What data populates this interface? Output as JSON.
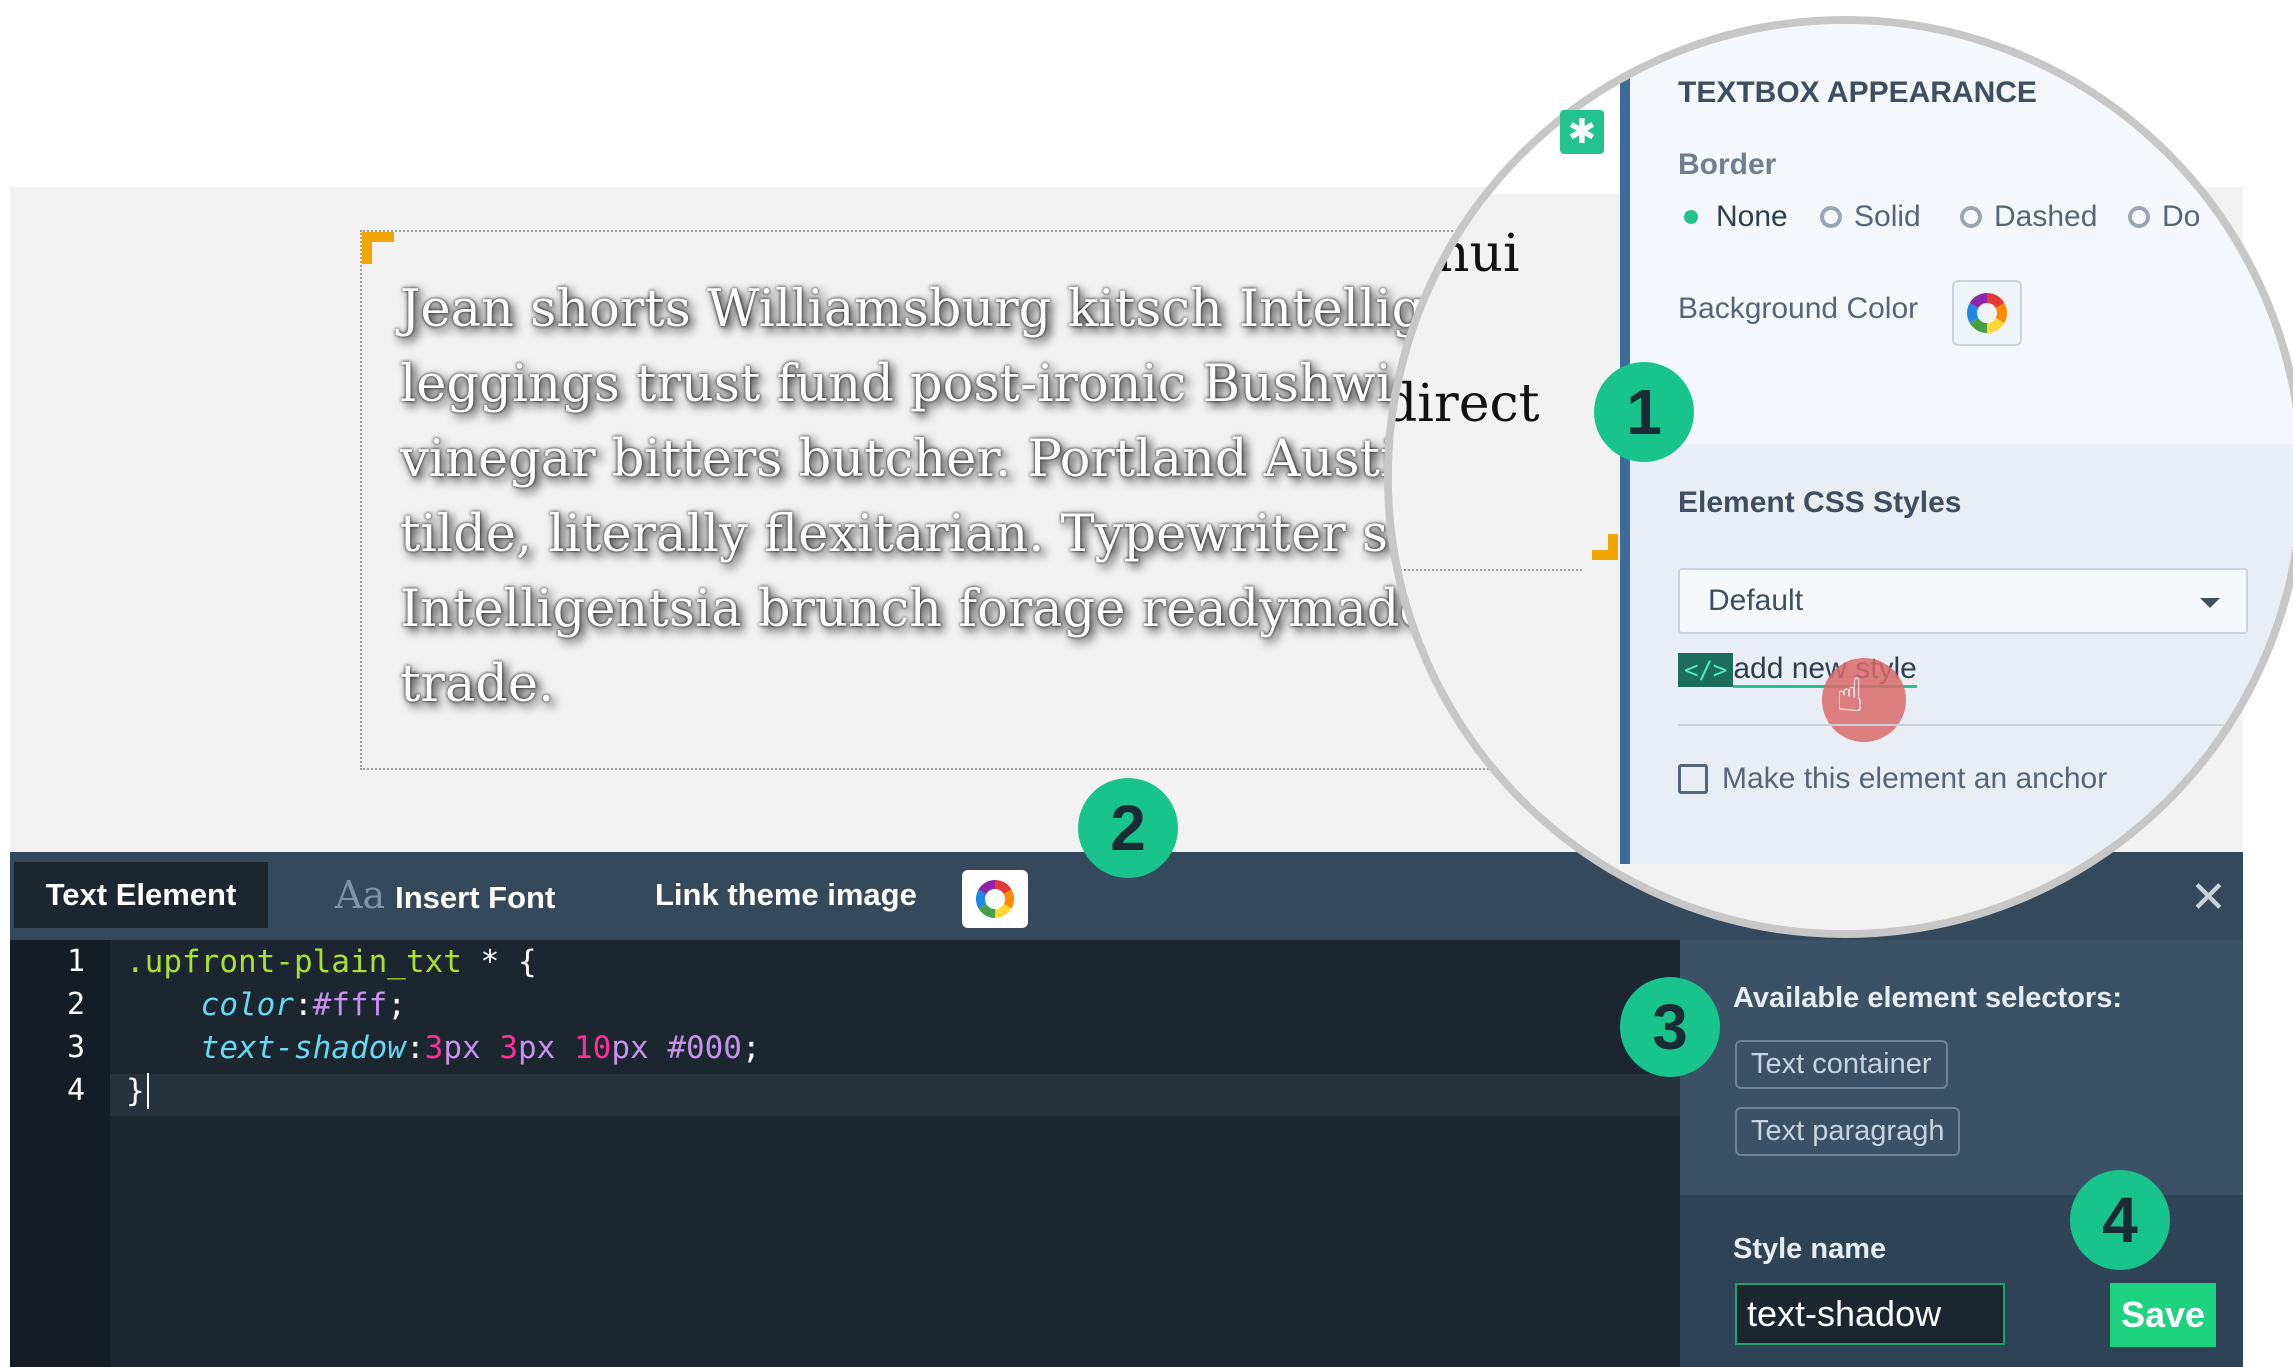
{
  "canvas": {
    "paragraph_lines": [
      "Jean shorts Williamsburg kitsch Intelligen",
      "leggings trust fund post-ironic Bushwick",
      "vinegar bitters butcher. Portland Austin",
      "tilde, literally flexitarian. Typewriter self",
      "Intelligentsia brunch forage readymade p",
      "trade."
    ],
    "peek_text": [
      "hui",
      "direct"
    ],
    "settings_icon": "gear-icon"
  },
  "editor": {
    "tabs": {
      "text_element": "Text Element",
      "insert_font_glyph": "Aa",
      "insert_font": "Insert Font",
      "link_theme_image": "Link theme image"
    },
    "close_glyph": "✕",
    "line_numbers": [
      "1",
      "2",
      "3",
      "4"
    ],
    "code": {
      "line1_selector": ".upfront-plain_txt",
      "line1_rest": " * {",
      "line2_prop": "color",
      "line2_value": "#fff",
      "line3_prop": "text-shadow",
      "line3_v1": "3",
      "line3_v1u": "px",
      "line3_v2": "3",
      "line3_v2u": "px",
      "line3_v3": "10",
      "line3_v3u": "px",
      "line3_v4": "#000",
      "line4": "}"
    },
    "selectors_label": "Available element selectors:",
    "selectors": [
      "Text container",
      "Text paragragh"
    ],
    "style_name_label": "Style name",
    "style_name_value": "text-shadow",
    "save_label": "Save"
  },
  "magnifier": {
    "section_title": "TEXTBOX APPEARANCE",
    "border_label": "Border",
    "border_options": [
      "None",
      "Solid",
      "Dashed",
      "Do"
    ],
    "border_selected": "None",
    "bg_color_label": "Background Color",
    "css_styles_label": "Element CSS Styles",
    "css_select_value": "Default",
    "code_tag": "</>",
    "add_style_label": "add new style",
    "anchor_label": "Make this element an anchor"
  },
  "steps": [
    "1",
    "2",
    "3",
    "4"
  ],
  "colors": {
    "accent_green": "#19c38c",
    "editor_bg": "#1b2631",
    "tabbar_bg": "#34495c",
    "textbox_handle": "#f0a500"
  }
}
